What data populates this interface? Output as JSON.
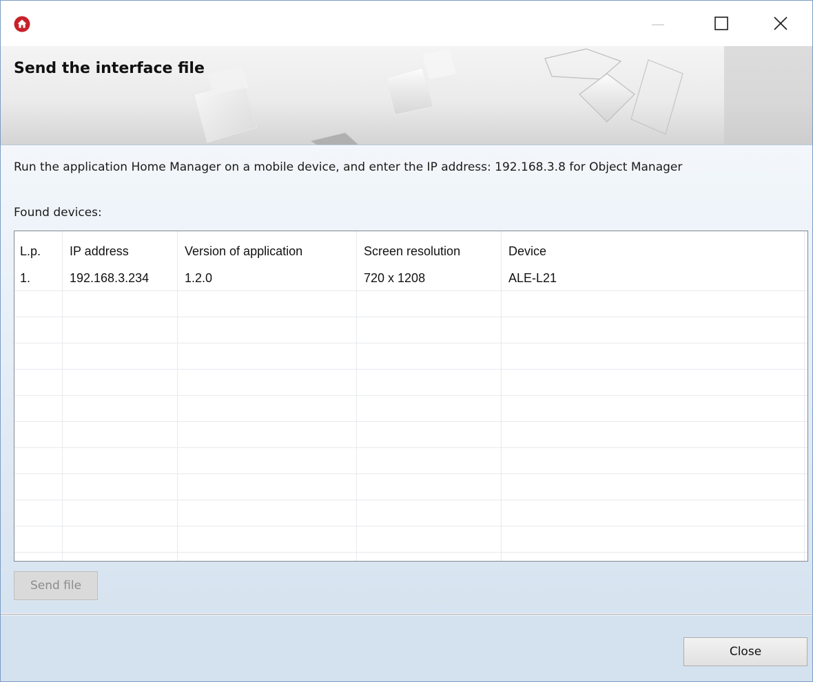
{
  "window": {
    "app_icon": "home-app-icon",
    "accent_color": "#c8202a",
    "controls": {
      "minimize_icon": "minimize-icon",
      "maximize_icon": "maximize-icon",
      "close_icon": "close-icon"
    }
  },
  "banner": {
    "title": "Send the interface file"
  },
  "content": {
    "instruction": "Run the application Home Manager on a mobile device, and enter the IP address: 192.168.3.8 for Object Manager",
    "found_label": "Found devices:"
  },
  "devices_table": {
    "columns": [
      "L.p.",
      "IP address",
      "Version of application",
      "Screen resolution",
      "Device"
    ],
    "rows": [
      [
        "1.",
        "192.168.3.234",
        "1.2.0",
        "720 x 1208",
        "ALE-L21"
      ]
    ]
  },
  "buttons": {
    "send_file": "Send file",
    "close": "Close"
  }
}
